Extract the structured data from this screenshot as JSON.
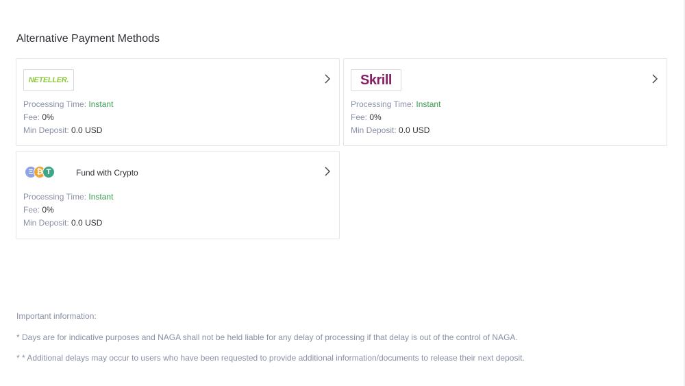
{
  "section": {
    "title": "Alternative Payment Methods"
  },
  "methods": [
    {
      "logo_text": "NETELLER.",
      "processing_label": "Processing Time:",
      "processing_value": "Instant",
      "fee_label": "Fee:",
      "fee_value": "0%",
      "min_label": "Min Deposit:",
      "min_value": "0.0 USD"
    },
    {
      "logo_text": "Skrill",
      "processing_label": "Processing Time:",
      "processing_value": "Instant",
      "fee_label": "Fee:",
      "fee_value": "0%",
      "min_label": "Min Deposit:",
      "min_value": "0.0 USD"
    },
    {
      "name": "Fund with Crypto",
      "coins": [
        "Ξ",
        "₿",
        "T"
      ],
      "processing_label": "Processing Time:",
      "processing_value": "Instant",
      "fee_label": "Fee:",
      "fee_value": "0%",
      "min_label": "Min Deposit:",
      "min_value": "0.0 USD"
    }
  ],
  "important": {
    "title": "Important information:",
    "note1": "* Days are for indicative purposes and NAGA shall not be held liable for any delay of processing if that delay is out of the control of NAGA.",
    "note2": "* * Additional delays may occur to users who have been requested to provide additional information/documents to release their next deposit."
  },
  "icons": {
    "chevron": "chevron-right-icon",
    "eth": "ethereum-icon",
    "btc": "bitcoin-icon",
    "usdt": "tether-icon"
  },
  "colors": {
    "accent_green": "#3a9b4f",
    "label_gray": "#8a90a5",
    "neteller_green": "#8cc63f",
    "skrill_purple": "#862165"
  }
}
